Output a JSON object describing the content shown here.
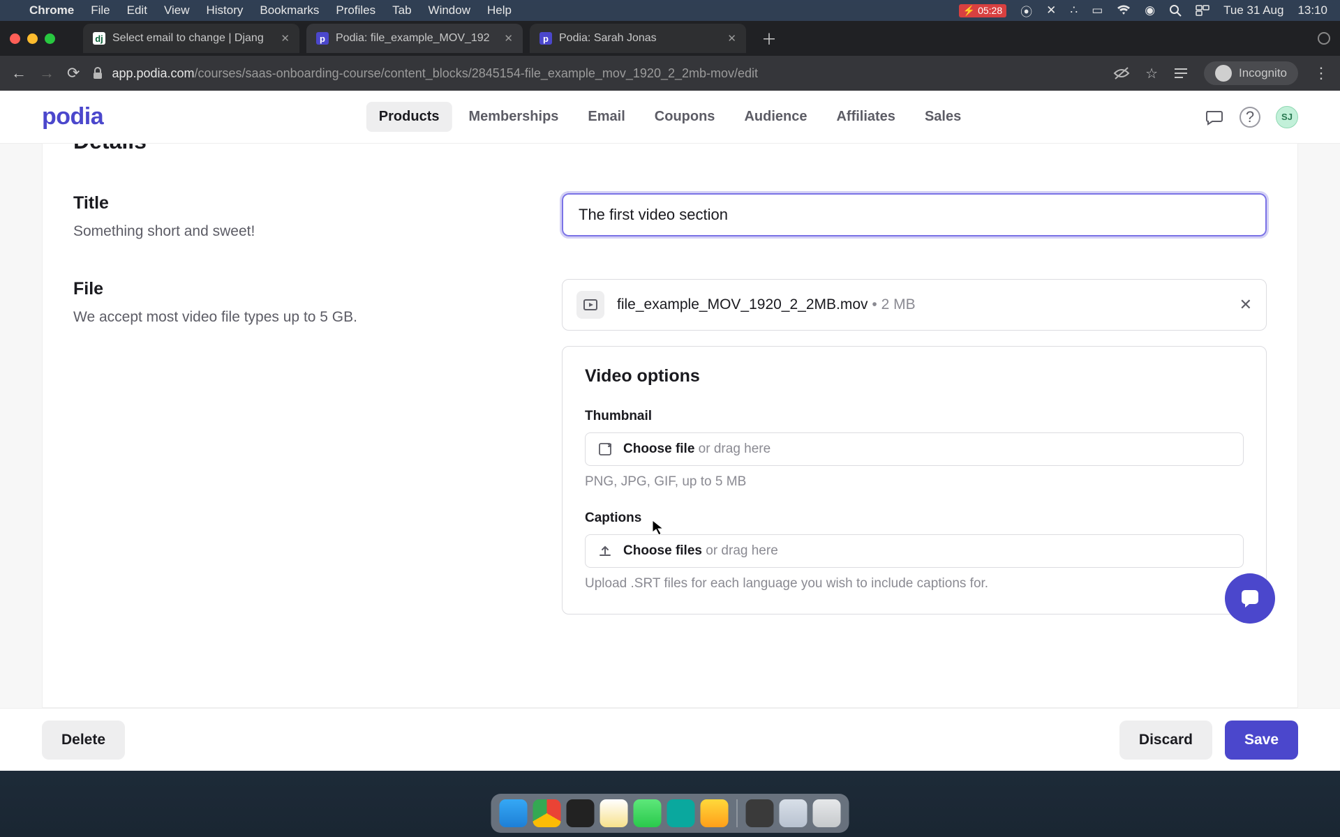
{
  "mac_menu": {
    "app": "Chrome",
    "items": [
      "File",
      "Edit",
      "View",
      "History",
      "Bookmarks",
      "Profiles",
      "Tab",
      "Window",
      "Help"
    ],
    "battery_time": "05:28",
    "date": "Tue 31 Aug",
    "clock": "13:10"
  },
  "browser": {
    "tabs": [
      {
        "title": "Select email to change | Djang",
        "favicon": "dj"
      },
      {
        "title": "Podia: file_example_MOV_192",
        "favicon": "p",
        "active": true
      },
      {
        "title": "Podia: Sarah Jonas",
        "favicon": "p"
      }
    ],
    "url_host": "app.podia.com",
    "url_path": "/courses/saas-onboarding-course/content_blocks/2845154-file_example_mov_1920_2_2mb-mov/edit",
    "incognito_label": "Incognito"
  },
  "header": {
    "logo": "podia",
    "nav": [
      "Products",
      "Memberships",
      "Email",
      "Coupons",
      "Audience",
      "Affiliates",
      "Sales"
    ],
    "nav_active": "Products",
    "avatar_initials": "SJ"
  },
  "editor": {
    "cut_heading": "Details",
    "title": {
      "label": "Title",
      "desc": "Something short and sweet!",
      "value": "The first video section"
    },
    "file": {
      "label": "File",
      "desc": "We accept most video file types up to 5 GB.",
      "filename": "file_example_MOV_1920_2_2MB.mov",
      "size": "2 MB"
    },
    "video_options": {
      "heading": "Video options",
      "thumbnail": {
        "label": "Thumbnail",
        "choose": "Choose file",
        "drag": " or drag here",
        "hint": "PNG, JPG, GIF, up to 5 MB"
      },
      "captions": {
        "label": "Captions",
        "choose": "Choose files",
        "drag": " or drag here",
        "hint": "Upload .SRT files for each language you wish to include captions for."
      }
    }
  },
  "actions": {
    "delete": "Delete",
    "discard": "Discard",
    "save": "Save"
  }
}
